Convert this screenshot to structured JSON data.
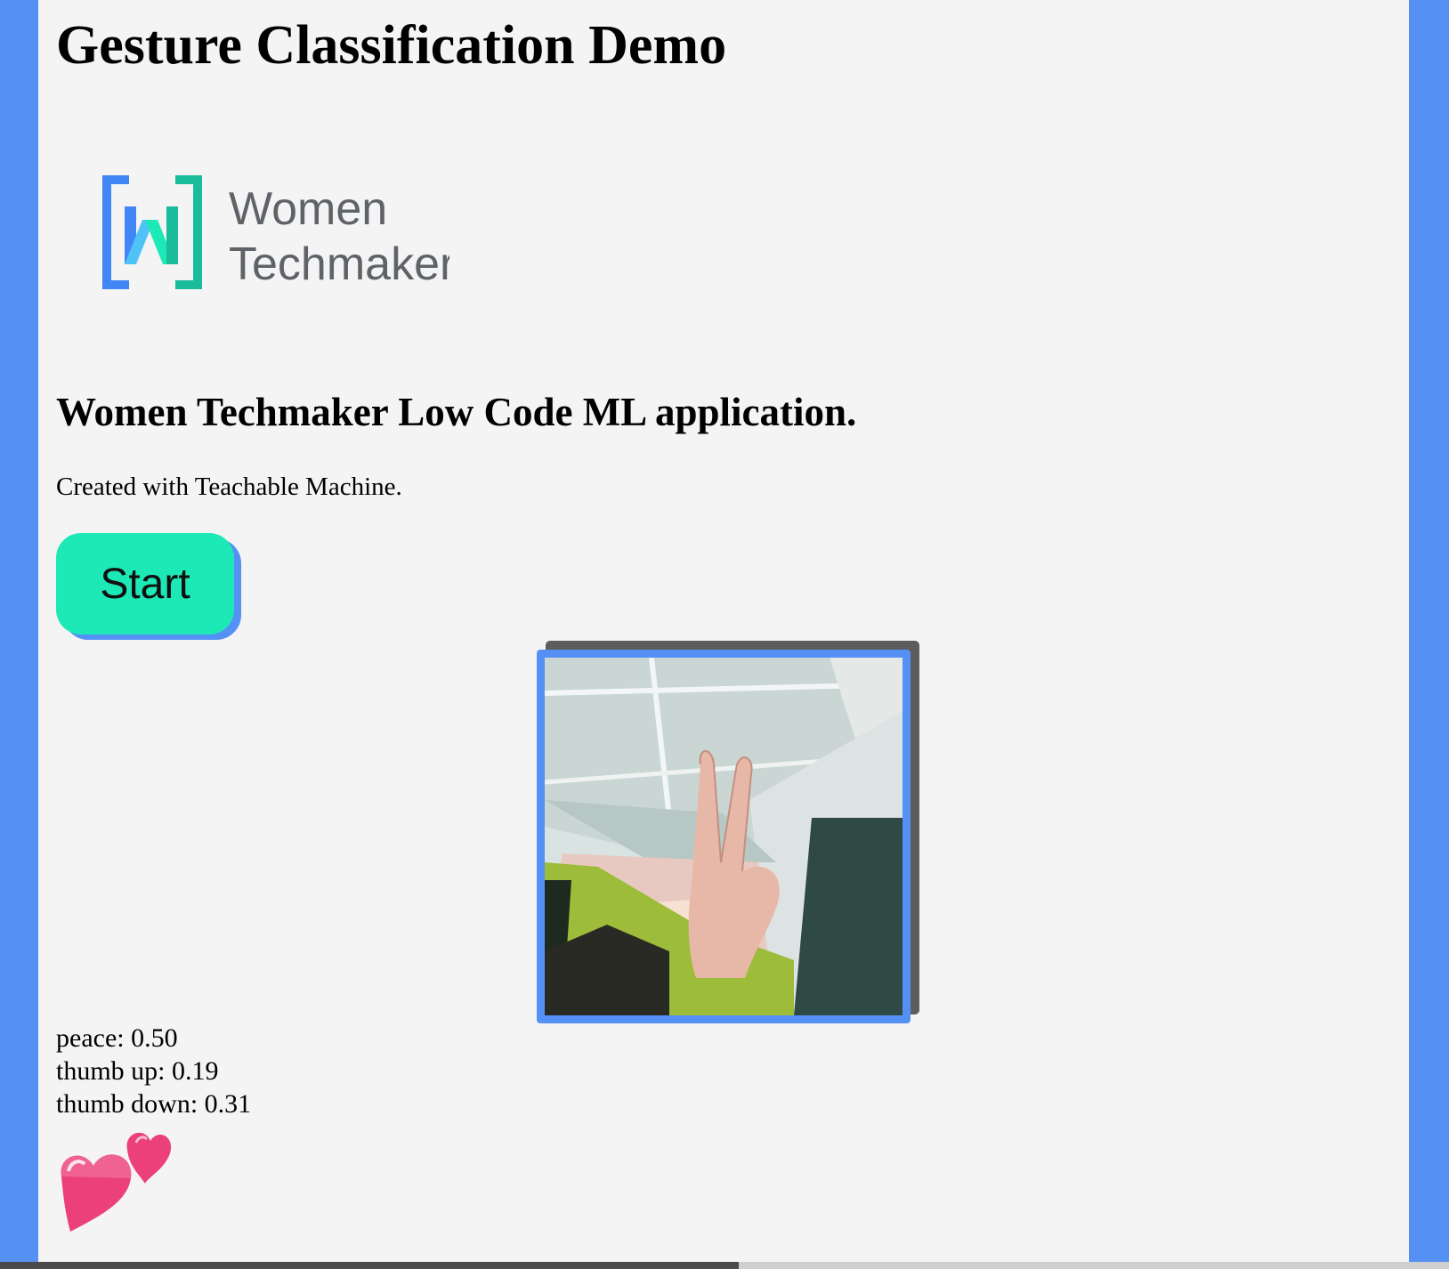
{
  "header": {
    "title": "Gesture Classification Demo"
  },
  "logo": {
    "line1": "Women",
    "line2": "Techmakers",
    "colors": {
      "blue": "#4285f4",
      "teal": "#1de9b6",
      "text": "#5f6368"
    }
  },
  "intro": {
    "subtitle": "Women Techmaker Low Code ML application.",
    "created": "Created with Teachable Machine."
  },
  "controls": {
    "start_label": "Start"
  },
  "webcam": {
    "description_icon": "webcam-feed"
  },
  "predictions": [
    {
      "label": "peace: 0.50"
    },
    {
      "label": "thumb up: 0.19"
    },
    {
      "label": "thumb down: 0.31"
    }
  ],
  "result_icon": "two-hearts-icon",
  "colors": {
    "accent": "#5591f5",
    "button": "#1de9b6",
    "background": "#f4f4f4"
  }
}
